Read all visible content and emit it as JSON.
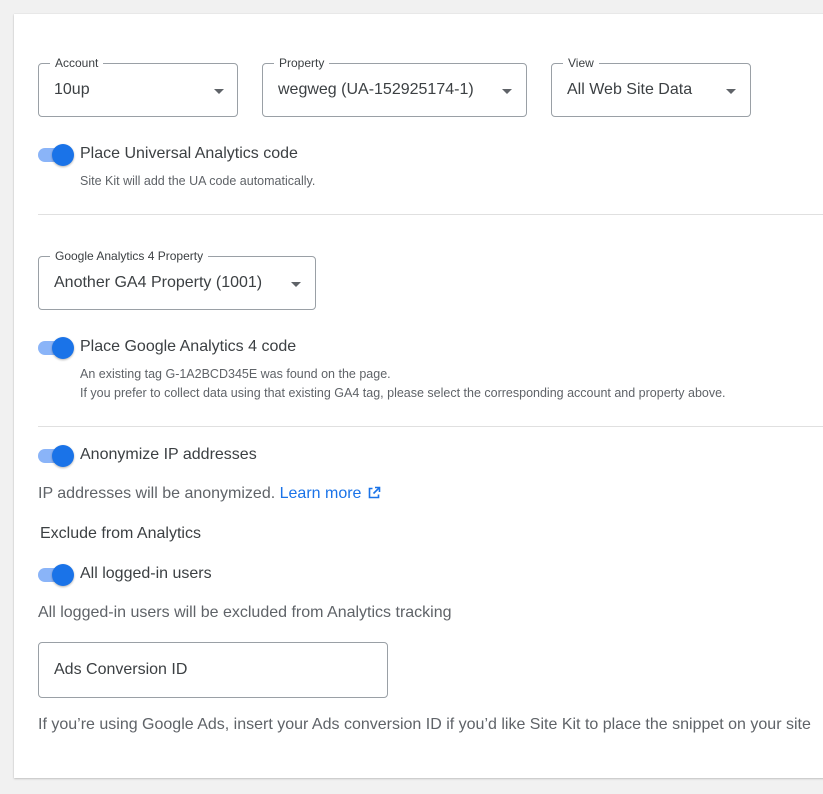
{
  "ua_section": {
    "account": {
      "legend": "Account",
      "value": "10up"
    },
    "property": {
      "legend": "Property",
      "value": "wegweg (UA-152925174-1)"
    },
    "view": {
      "legend": "View",
      "value": "All Web Site Data"
    },
    "toggle_label": "Place Universal Analytics code",
    "toggle_on": true,
    "help": "Site Kit will add the UA code automatically."
  },
  "ga4_section": {
    "property": {
      "legend": "Google Analytics 4 Property",
      "value": "Another GA4 Property (1001)"
    },
    "toggle_label": "Place Google Analytics 4 code",
    "toggle_on": true,
    "help_line1": "An existing tag G-1A2BCD345E was found on the page.",
    "help_line2": "If you prefer to collect data using that existing GA4 tag, please select the corresponding account and property above."
  },
  "anonymize": {
    "toggle_label": "Anonymize IP addresses",
    "toggle_on": true,
    "description": "IP addresses will be anonymized.",
    "learn_more": "Learn more"
  },
  "exclude": {
    "heading": "Exclude from Analytics",
    "toggle_label": "All logged-in users",
    "toggle_on": true,
    "description": "All logged-in users will be excluded from Analytics tracking"
  },
  "ads": {
    "placeholder": "Ads Conversion ID",
    "value": "",
    "help": "If you’re using Google Ads, insert your Ads conversion ID if you’d like Site Kit to place the snippet on your site"
  },
  "colors": {
    "accent": "#1a73e8",
    "accent_track": "#8ab4f8",
    "text": "#3c4043",
    "muted": "#5f6368",
    "border": "#9aa0a6",
    "divider": "#e0e0e0"
  },
  "icons": {
    "dropdown": "caret-down-icon",
    "external_link": "external-link-icon"
  }
}
